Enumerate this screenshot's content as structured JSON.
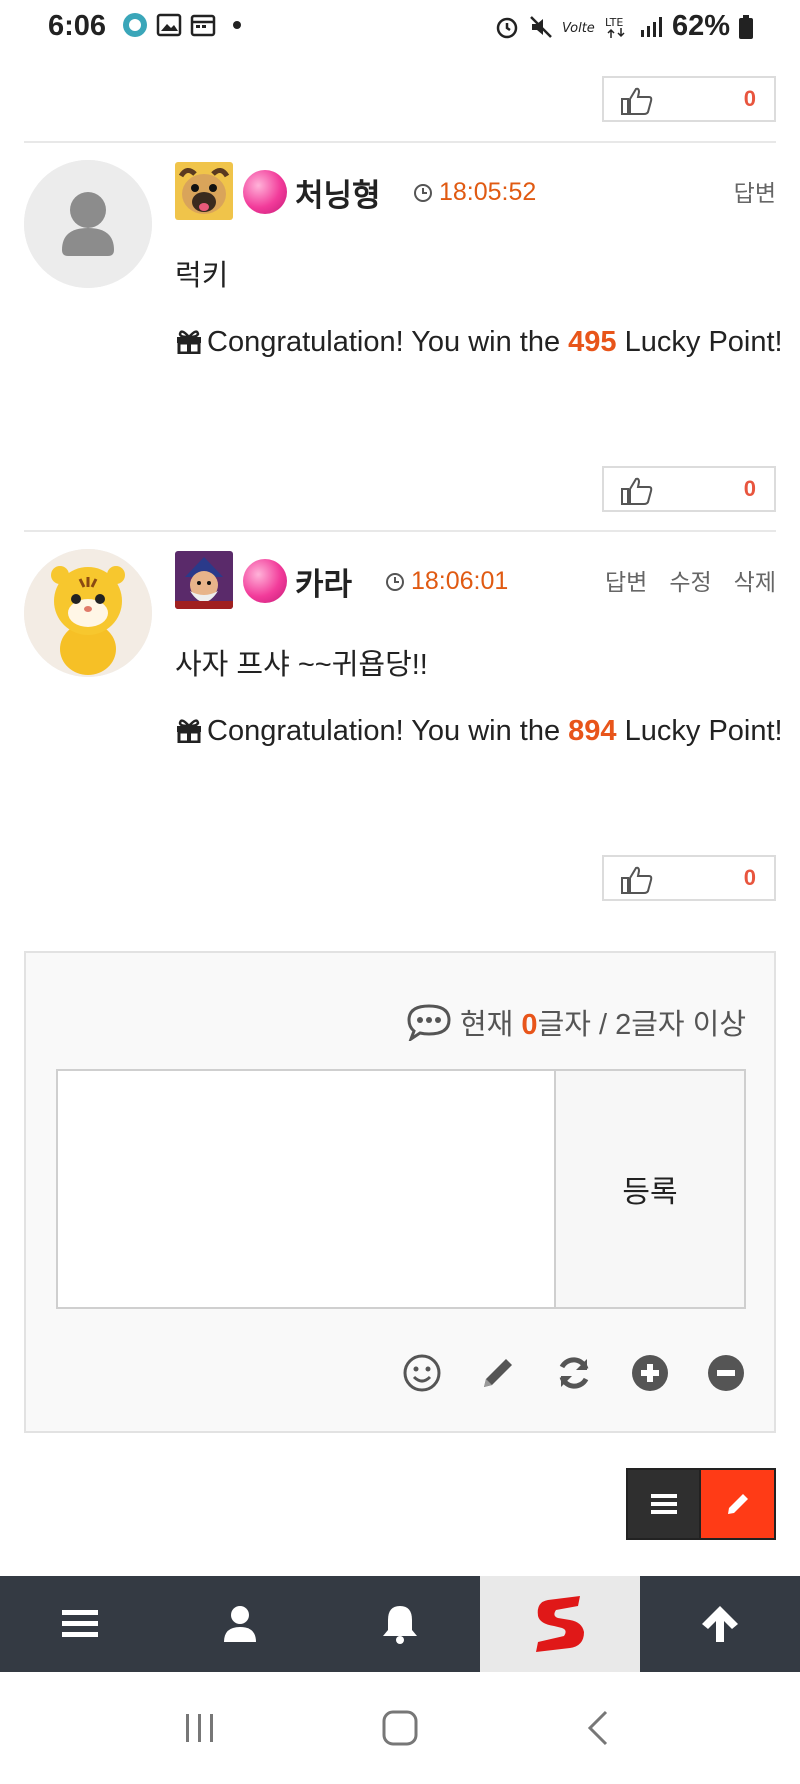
{
  "status_bar": {
    "time": "6:06",
    "battery": "62%"
  },
  "comments": [
    {
      "like_count": "0"
    },
    {
      "nickname": "처닝형",
      "time": "18:05:52",
      "actions": [
        "답변"
      ],
      "text": "럭키",
      "reward_prefix": "Congratulation! You win the",
      "reward_points": "495",
      "reward_suffix": "Lucky Point!",
      "like_count": "0"
    },
    {
      "nickname": "카라",
      "time": "18:06:01",
      "actions": [
        "답변",
        "수정",
        "삭제"
      ],
      "text": "사자 프샤 ~~귀욥당!!",
      "reward_prefix": "Congratulation! You win the",
      "reward_points": "894",
      "reward_suffix": "Lucky Point!",
      "like_count": "0"
    }
  ],
  "comment_form": {
    "count_prefix": "현재",
    "count_value": "0",
    "count_suffix": "글자 / 2글자 이상",
    "submit_label": "등록",
    "textarea_placeholder": ""
  },
  "tools": [
    "emoji-icon",
    "pencil-icon",
    "refresh-icon",
    "plus-circle-icon",
    "minus-circle-icon"
  ],
  "bottom_nav": [
    "menu-icon",
    "user-icon",
    "bell-icon",
    "site-logo",
    "arrow-up-icon"
  ],
  "colors": {
    "accent_orange": "#e8551a",
    "write_button": "#ff3b16",
    "nav_bg": "#343a43",
    "time_color": "#e05a12"
  }
}
